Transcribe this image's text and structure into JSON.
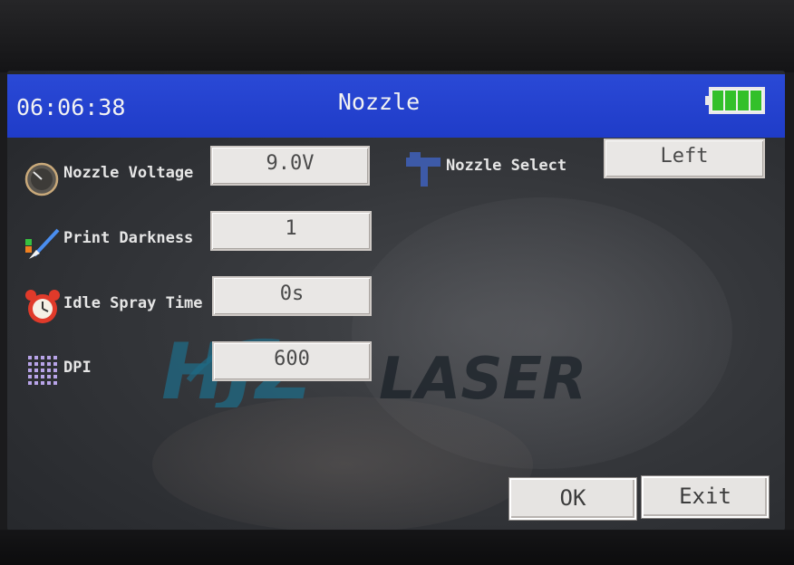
{
  "header": {
    "time": "06:06:38",
    "title": "Nozzle",
    "battery_level": 1.0
  },
  "settings": {
    "nozzle_voltage": {
      "label": "Nozzle Voltage",
      "value": "9.0V"
    },
    "print_darkness": {
      "label": "Print Darkness",
      "value": "1"
    },
    "idle_spray_time": {
      "label": "Idle Spray Time",
      "value": "0s"
    },
    "dpi": {
      "label": "DPI",
      "value": "600"
    },
    "nozzle_select": {
      "label": "Nozzle Select",
      "value": "Left"
    }
  },
  "buttons": {
    "ok": "OK",
    "exit": "Exit"
  },
  "watermark": {
    "text_a": "HJZ",
    "text_b": "LASER"
  },
  "colors": {
    "title_bar": "#1f3cc8",
    "battery": "#33c02a"
  },
  "icons": {
    "nozzle_voltage": "gauge-icon",
    "print_darkness": "brush-icon",
    "idle_spray_time": "alarm-clock-icon",
    "dpi": "dot-grid-icon",
    "nozzle_select": "nozzle-icon"
  }
}
